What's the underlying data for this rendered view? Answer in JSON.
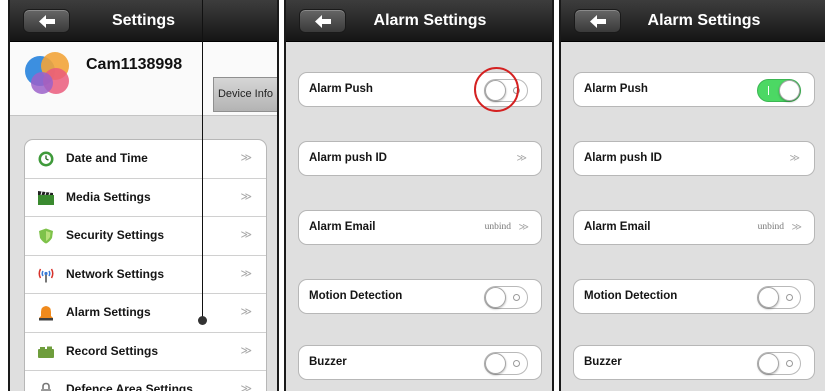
{
  "colors": {
    "navbar": "#1f1f1f",
    "toggle_on": "#4cd864",
    "highlight_ring": "#d42121"
  },
  "panel_device_settings": {
    "title": "Settings",
    "back_icon": "back-arrow-icon",
    "device": {
      "name": "Cam1138998",
      "info_button": "Device Info"
    },
    "menu": [
      {
        "label": "Date and Time",
        "icon": "clock-icon",
        "chevron": "≫"
      },
      {
        "label": "Media Settings",
        "icon": "clapperboard-icon",
        "chevron": "≫"
      },
      {
        "label": "Security Settings",
        "icon": "shield-icon",
        "chevron": "≫"
      },
      {
        "label": "Network Settings",
        "icon": "antenna-icon",
        "chevron": "≫"
      },
      {
        "label": "Alarm Settings",
        "icon": "bell-icon",
        "chevron": "≫"
      },
      {
        "label": "Record Settings",
        "icon": "camera-icon",
        "chevron": "≫"
      },
      {
        "label": "Defence Area Settings",
        "icon": "lock-icon",
        "chevron": "≫"
      }
    ]
  },
  "panel_alarm_before": {
    "title": "Alarm Settings",
    "rows": [
      {
        "label": "Alarm Push",
        "toggle_on": false
      },
      {
        "label": "Alarm push ID",
        "chevron": "≫"
      },
      {
        "label": "Alarm Email",
        "status": "unbind",
        "chevron": "≫"
      },
      {
        "label": "Motion Detection",
        "toggle_on": false
      },
      {
        "label": "Buzzer",
        "toggle_on": false
      }
    ]
  },
  "panel_alarm_after": {
    "title": "Alarm Settings",
    "rows": [
      {
        "label": "Alarm Push",
        "toggle_on": true
      },
      {
        "label": "Alarm push ID",
        "chevron": "≫"
      },
      {
        "label": "Alarm Email",
        "status": "unbind",
        "chevron": "≫"
      },
      {
        "label": "Motion Detection",
        "toggle_on": false
      },
      {
        "label": "Buzzer",
        "toggle_on": false
      }
    ]
  }
}
